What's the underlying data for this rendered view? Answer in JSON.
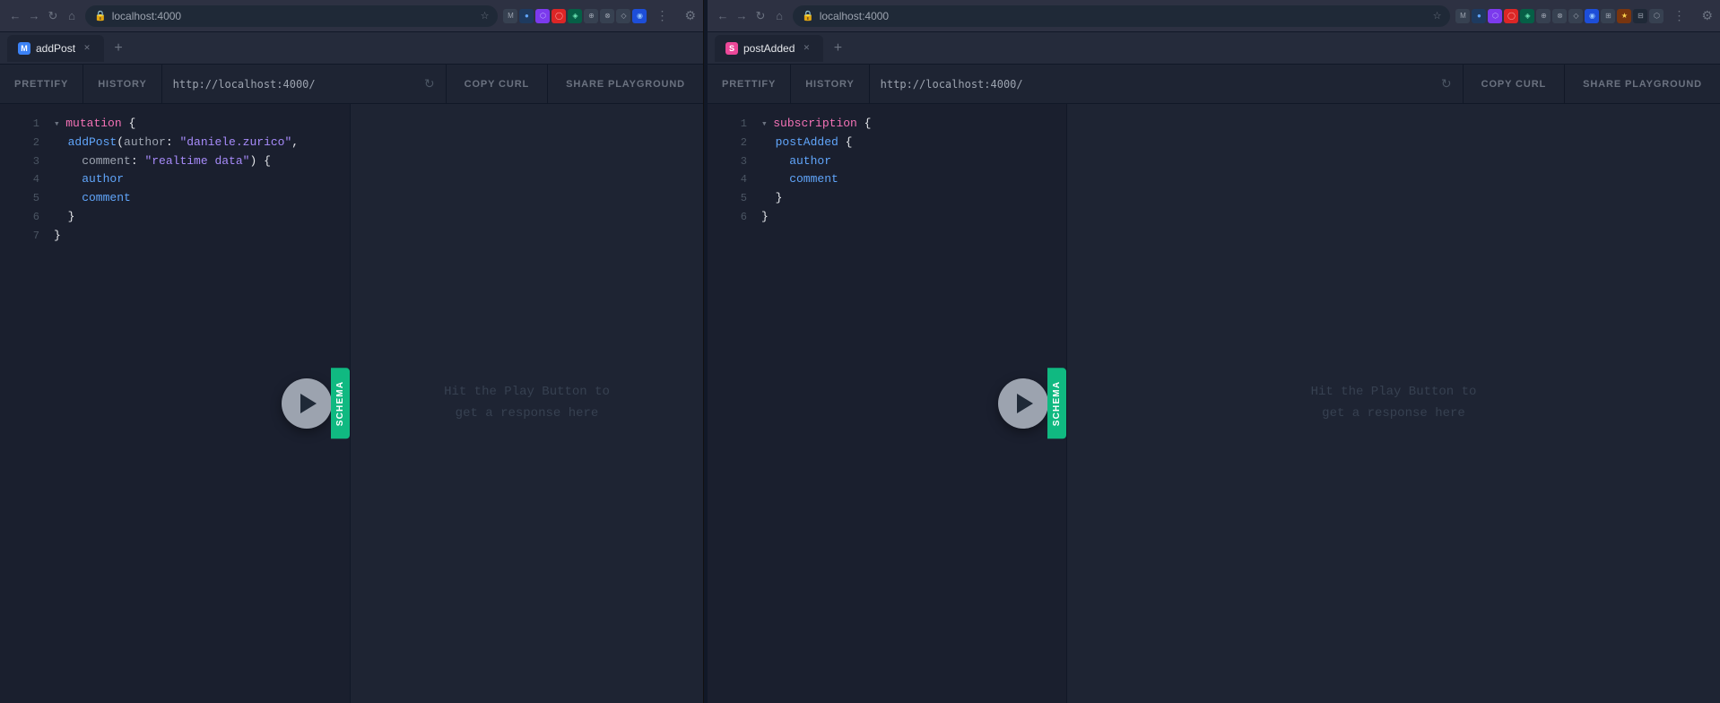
{
  "window1": {
    "url": "localhost:4000",
    "tab": {
      "label": "addPost",
      "favicon_letter": "M",
      "favicon_color": "#3b82f6"
    },
    "toolbar": {
      "prettify_label": "PRETTIFY",
      "history_label": "HISTORY",
      "url_value": "http://localhost:4000/",
      "copy_curl_label": "COPY CURL",
      "share_label": "SHARE PLAYGROUND"
    },
    "editor": {
      "lines": [
        {
          "num": 1,
          "tokens": [
            {
              "type": "collapse",
              "text": "▾ "
            },
            {
              "type": "kw-type",
              "text": "mutation"
            },
            {
              "type": "kw-punct",
              "text": " {"
            }
          ]
        },
        {
          "num": 2,
          "tokens": [
            {
              "type": "kw-field",
              "text": "  addPost"
            },
            {
              "type": "kw-punct",
              "text": "("
            },
            {
              "type": "kw-arg",
              "text": "author"
            },
            {
              "type": "kw-punct",
              "text": ": "
            },
            {
              "type": "kw-string",
              "text": "\"daniele.zurico\""
            },
            {
              "type": "kw-punct",
              "text": ","
            }
          ]
        },
        {
          "num": 3,
          "tokens": [
            {
              "type": "kw-arg",
              "text": "    comment"
            },
            {
              "type": "kw-punct",
              "text": ": "
            },
            {
              "type": "kw-string",
              "text": "\"realtime data\""
            },
            {
              "type": "kw-punct",
              "text": ") {"
            }
          ]
        },
        {
          "num": 4,
          "tokens": [
            {
              "type": "kw-field",
              "text": "    author"
            }
          ]
        },
        {
          "num": 5,
          "tokens": [
            {
              "type": "kw-field",
              "text": "    comment"
            }
          ]
        },
        {
          "num": 6,
          "tokens": [
            {
              "type": "kw-punct",
              "text": "  }"
            }
          ]
        },
        {
          "num": 7,
          "tokens": [
            {
              "type": "kw-punct",
              "text": "}"
            }
          ]
        }
      ]
    },
    "response": {
      "placeholder_line1": "Hit the Play Button to",
      "placeholder_line2": "get a response here"
    },
    "schema_label": "SCHEMA",
    "play_label": "Run query"
  },
  "window2": {
    "url": "localhost:4000",
    "tab": {
      "label": "postAdded",
      "favicon_letter": "S",
      "favicon_color": "#ec4899"
    },
    "toolbar": {
      "prettify_label": "PRETTIFY",
      "history_label": "HISTORY",
      "url_value": "http://localhost:4000/",
      "copy_curl_label": "COPY CURL",
      "share_label": "SHARE PLAYGROUND"
    },
    "editor": {
      "lines": [
        {
          "num": 1,
          "tokens": [
            {
              "type": "collapse",
              "text": "▾ "
            },
            {
              "type": "kw-type",
              "text": "subscription"
            },
            {
              "type": "kw-punct",
              "text": " {"
            }
          ]
        },
        {
          "num": 2,
          "tokens": [
            {
              "type": "kw-field",
              "text": "  postAdded"
            },
            {
              "type": "kw-punct",
              "text": " {"
            }
          ]
        },
        {
          "num": 3,
          "tokens": [
            {
              "type": "kw-field",
              "text": "    author"
            }
          ]
        },
        {
          "num": 4,
          "tokens": [
            {
              "type": "kw-field",
              "text": "    comment"
            }
          ]
        },
        {
          "num": 5,
          "tokens": [
            {
              "type": "kw-punct",
              "text": "  }"
            }
          ]
        },
        {
          "num": 6,
          "tokens": [
            {
              "type": "kw-punct",
              "text": "}"
            }
          ]
        }
      ]
    },
    "response": {
      "placeholder_line1": "Hit the Play Button to",
      "placeholder_line2": "get a response here"
    },
    "schema_label": "SCHEMA",
    "play_label": "Run subscription"
  }
}
